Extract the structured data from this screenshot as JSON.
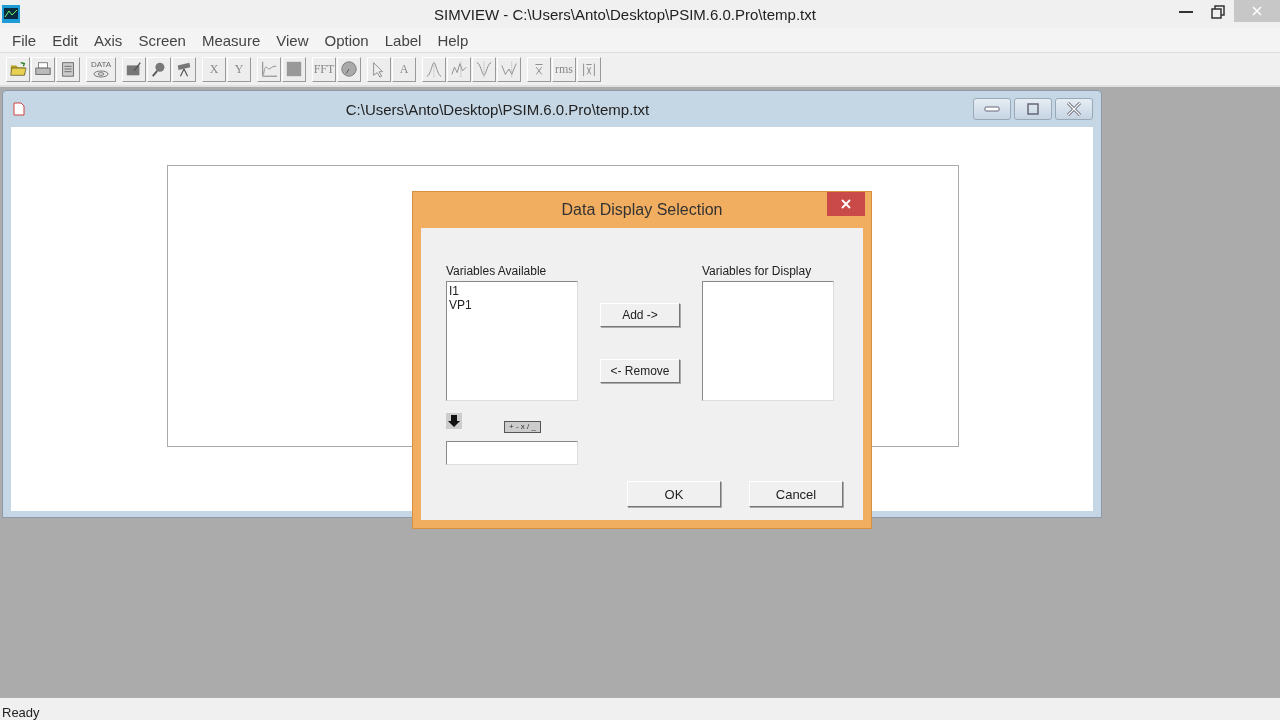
{
  "window": {
    "title": "SIMVIEW - C:\\Users\\Anto\\Desktop\\PSIM.6.0.Pro\\temp.txt"
  },
  "menu": [
    "File",
    "Edit",
    "Axis",
    "Screen",
    "Measure",
    "View",
    "Option",
    "Label",
    "Help"
  ],
  "toolbar": [
    [
      {
        "kind": "icon"
      },
      {
        "kind": "icon"
      },
      {
        "kind": "icon"
      }
    ],
    [
      {
        "kind": "labeled-icon",
        "label": "DATA"
      }
    ],
    [
      {
        "kind": "icon"
      },
      {
        "kind": "icon"
      },
      {
        "kind": "icon"
      }
    ],
    [
      {
        "kind": "text",
        "label": "X"
      },
      {
        "kind": "text",
        "label": "Y"
      }
    ],
    [
      {
        "kind": "icon"
      },
      {
        "kind": "icon"
      }
    ],
    [
      {
        "kind": "text",
        "label": "FFT"
      },
      {
        "kind": "icon"
      }
    ],
    [
      {
        "kind": "icon"
      },
      {
        "kind": "text",
        "label": "A"
      }
    ],
    [
      {
        "kind": "icon"
      },
      {
        "kind": "icon"
      },
      {
        "kind": "icon"
      },
      {
        "kind": "icon"
      }
    ],
    [
      {
        "kind": "icon"
      },
      {
        "kind": "text",
        "label": "rms"
      },
      {
        "kind": "icon"
      }
    ]
  ],
  "child_window": {
    "title": "C:\\Users\\Anto\\Desktop\\PSIM.6.0.Pro\\temp.txt"
  },
  "dialog": {
    "title": "Data Display Selection",
    "available": {
      "label": "Variables Available",
      "items": [
        "I1",
        "VP1"
      ]
    },
    "display": {
      "label": "Variables for Display"
    },
    "add_button": "Add ->",
    "remove_button": "<- Remove",
    "operators": "+ - x / _",
    "buttons": [
      "OK",
      "Cancel"
    ]
  },
  "status_bar": "Ready"
}
